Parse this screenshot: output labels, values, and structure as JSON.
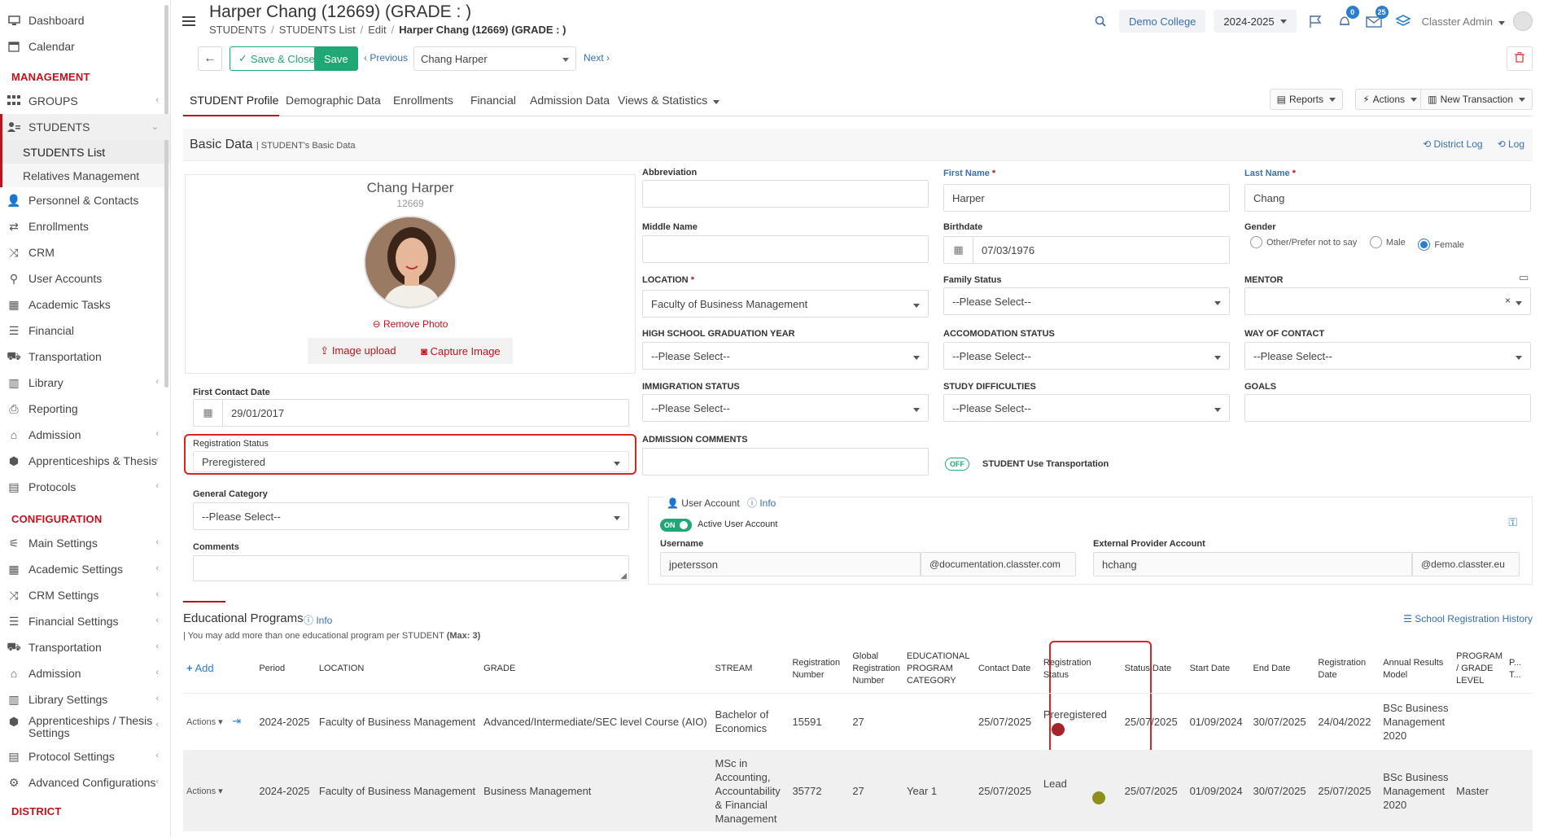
{
  "sidebar": {
    "top_items": [
      {
        "label": "Dashboard",
        "icon": "monitor-icon"
      },
      {
        "label": "Calendar",
        "icon": "calendar-icon"
      }
    ],
    "management_label": "MANAGEMENT",
    "management_items": [
      {
        "label": "GROUPS",
        "icon": "groups-icon"
      },
      {
        "label": "STUDENTS",
        "icon": "students-icon"
      }
    ],
    "students_sub": [
      "STUDENTS List",
      "Relatives Management"
    ],
    "management_items_2": [
      {
        "label": "Personnel & Contacts",
        "icon": "person-icon"
      },
      {
        "label": "Enrollments",
        "icon": "arrows-icon"
      },
      {
        "label": "CRM",
        "icon": "crm-icon"
      },
      {
        "label": "User Accounts",
        "icon": "key-icon"
      },
      {
        "label": "Academic Tasks",
        "icon": "tasks-icon"
      },
      {
        "label": "Financial",
        "icon": "coins-icon"
      },
      {
        "label": "Transportation",
        "icon": "bus-icon"
      },
      {
        "label": "Library",
        "icon": "library-icon"
      },
      {
        "label": "Reporting",
        "icon": "printer-icon"
      },
      {
        "label": "Admission",
        "icon": "building-icon"
      },
      {
        "label": "Apprenticeships & Thesis",
        "icon": "box-icon"
      },
      {
        "label": "Protocols",
        "icon": "protocol-icon"
      }
    ],
    "configuration_label": "CONFIGURATION",
    "configuration_items": [
      {
        "label": "Main Settings",
        "icon": "sliders-icon"
      },
      {
        "label": "Academic Settings",
        "icon": "groups-icon"
      },
      {
        "label": "CRM Settings",
        "icon": "crm-icon"
      },
      {
        "label": "Financial Settings",
        "icon": "coins-icon"
      },
      {
        "label": "Transportation",
        "icon": "bus-icon"
      },
      {
        "label": "Admission",
        "icon": "building-icon"
      },
      {
        "label": "Library Settings",
        "icon": "library-icon"
      },
      {
        "label": "Apprenticeships / Thesis Settings",
        "icon": "box-icon"
      },
      {
        "label": "Protocol Settings",
        "icon": "protocol-icon"
      },
      {
        "label": "Advanced Configurations",
        "icon": "gears-icon"
      }
    ],
    "district_label": "DISTRICT"
  },
  "header": {
    "title": "Harper Chang (12669) (GRADE : )",
    "breadcrumb": [
      "STUDENTS",
      "STUDENTS List",
      "Edit",
      "Harper Chang (12669) (GRADE : )"
    ],
    "college": "Demo College",
    "year": "2024-2025",
    "notif_count": "0",
    "messages_count": "25",
    "user": "Classter Admin"
  },
  "toolbar": {
    "save_close": "Save & Close",
    "save": "Save",
    "previous": "Previous",
    "student_select": "Chang Harper",
    "next": "Next"
  },
  "tabs": {
    "items": [
      "STUDENT Profile",
      "Demographic Data",
      "Enrollments",
      "Financial",
      "Admission Data",
      "Views & Statistics"
    ],
    "reports": "Reports",
    "actions": "Actions",
    "new_transaction": "New Transaction"
  },
  "basic_data": {
    "title": "Basic Data",
    "subtitle": "STUDENT's Basic Data",
    "district_log": "District Log",
    "log": "Log"
  },
  "profile": {
    "name": "Chang Harper",
    "id": "12669",
    "remove_photo": "Remove Photo",
    "image_upload": "Image upload",
    "capture_image": "Capture Image"
  },
  "form": {
    "first_contact_label": "First Contact Date",
    "first_contact_value": "29/01/2017",
    "reg_status_label": "Registration Status",
    "reg_status_value": "Preregistered",
    "general_category_label": "General Category",
    "general_category_value": "--Please Select--",
    "comments_label": "Comments",
    "abbreviation_label": "Abbreviation",
    "middle_name_label": "Middle Name",
    "location_label": "LOCATION",
    "location_value": "Faculty of Business Management",
    "hs_grad_label": "HIGH SCHOOL GRADUATION YEAR",
    "hs_grad_value": "--Please Select--",
    "immigration_label": "IMMIGRATION STATUS",
    "immigration_value": "--Please Select--",
    "admission_comments_label": "ADMISSION COMMENTS",
    "first_name_label": "First Name",
    "first_name_value": "Harper",
    "birthdate_label": "Birthdate",
    "birthdate_value": "07/03/1976",
    "family_status_label": "Family Status",
    "family_status_value": "--Please Select--",
    "accomodation_label": "ACCOMODATION STATUS",
    "accomodation_value": "--Please Select--",
    "study_diff_label": "STUDY DIFFICULTIES",
    "study_diff_value": "--Please Select--",
    "transport_toggle": "OFF",
    "transport_label": "STUDENT Use Transportation",
    "last_name_label": "Last Name",
    "last_name_value": "Chang",
    "gender_label": "Gender",
    "gender_options": [
      "Other/Prefer not to say",
      "Male",
      "Female"
    ],
    "gender_selected": "Female",
    "mentor_label": "MENTOR",
    "way_contact_label": "WAY OF CONTACT",
    "way_contact_value": "--Please Select--",
    "goals_label": "GOALS"
  },
  "user_account": {
    "title": "User Account",
    "info": "Info",
    "toggle": "ON",
    "active_label": "Active User Account",
    "username_label": "Username",
    "username_value": "jpetersson",
    "username_domain": "@documentation.classter.com",
    "external_label": "External Provider Account",
    "external_value": "hchang",
    "external_domain": "@demo.classter.eu"
  },
  "edu": {
    "title": "Educational Programs",
    "info": "Info",
    "note_prefix": "| You may add more than one educational program per STUDENT",
    "note_max": "(Max: 3)",
    "history": "School Registration History",
    "add": "Add",
    "headers": [
      "Period",
      "LOCATION",
      "GRADE",
      "STREAM",
      "Registration Number",
      "Global Registration Number",
      "EDUCATIONAL PROGRAM CATEGORY",
      "Contact Date",
      "Registration Status",
      "Status Date",
      "Start Date",
      "End Date",
      "Registration Date",
      "Annual Results Model",
      "PROGRAM / GRADE LEVEL",
      "P... T..."
    ],
    "rows": [
      {
        "actions": "Actions",
        "period": "2024-2025",
        "location": "Faculty of Business Management",
        "grade": "Advanced/Intermediate/SEC level Course (AIO)",
        "stream": "Bachelor of Economics",
        "reg_no": "15591",
        "global_no": "27",
        "category": "",
        "contact_date": "25/07/2025",
        "reg_status": "Preregistered",
        "dot_color": "#a5242c",
        "status_date": "25/07/2025",
        "start": "01/09/2024",
        "end": "30/07/2025",
        "reg_date": "24/04/2022",
        "results": "BSc Business Management 2020",
        "level": ""
      },
      {
        "actions": "Actions",
        "period": "2024-2025",
        "location": "Faculty of Business Management",
        "grade": "Business Management",
        "stream": "MSc in Accounting, Accountability & Financial Management",
        "reg_no": "35772",
        "global_no": "27",
        "category": "Year 1",
        "contact_date": "25/07/2025",
        "reg_status": "Lead",
        "dot_color": "#8f8f1c",
        "status_date": "25/07/2025",
        "start": "01/09/2024",
        "end": "30/07/2025",
        "reg_date": "25/07/2025",
        "results": "BSc Business Management 2020",
        "level": "Master"
      }
    ]
  },
  "colors": {
    "accent_red": "#c0121d",
    "green": "#1fa776",
    "link_blue": "#3a6fb0"
  }
}
